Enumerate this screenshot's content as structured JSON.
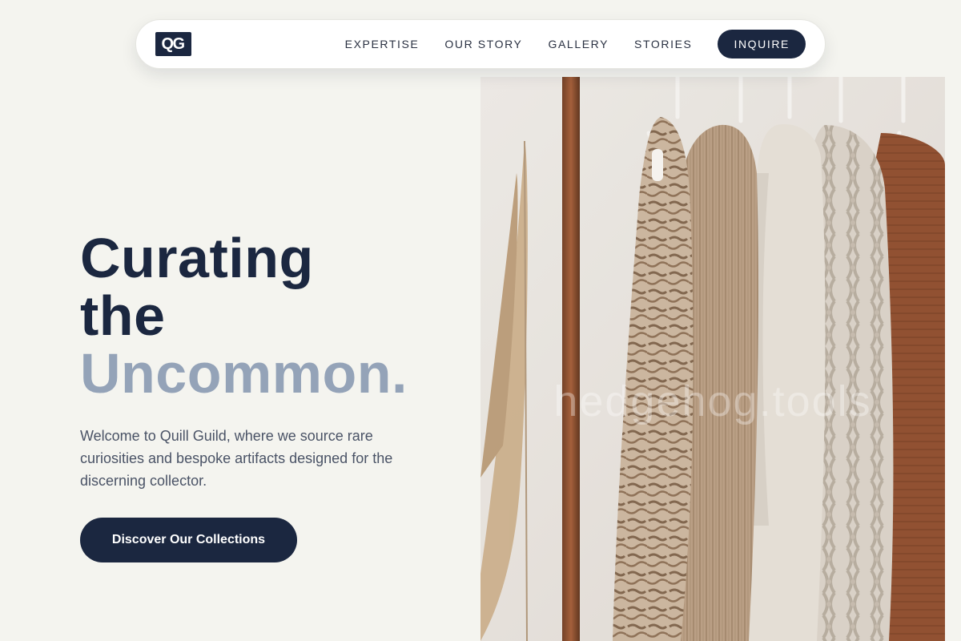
{
  "nav": {
    "logo": "QG",
    "links": [
      "EXPERTISE",
      "OUR STORY",
      "GALLERY",
      "STORIES"
    ],
    "cta": "INQUIRE"
  },
  "hero": {
    "title_line1": "Curating",
    "title_line2": "the",
    "title_line3": "Uncommon.",
    "description": "Welcome to Quill Guild, where we source rare curiosities and bespoke artifacts designed for the discerning collector.",
    "cta": "Discover Our Collections"
  },
  "image": {
    "subject": "clothing-rack-photo",
    "watermark": "hedgehog.tools"
  },
  "colors": {
    "background": "#f4f4ef",
    "primary": "#1b2740",
    "accent": "#94a3b8",
    "body_text": "#4a5366"
  }
}
